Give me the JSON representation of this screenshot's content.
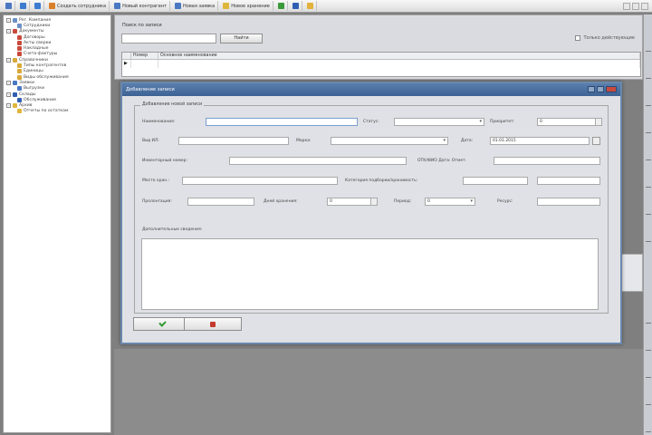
{
  "toolbar": {
    "items": [
      {
        "label": "",
        "icon": "back-icon",
        "color": "#4a78c2"
      },
      {
        "label": "",
        "icon": "up-icon",
        "color": "#3c7bd0"
      },
      {
        "label": "",
        "icon": "refresh-icon",
        "color": "#3c7bd0"
      },
      {
        "label": "Создать сотрудника",
        "icon": "new-employee-icon",
        "color": "#d97f2a"
      },
      {
        "label": "Новый контрагент",
        "icon": "new-contractor-icon",
        "color": "#4a78c2"
      },
      {
        "label": "Новая заявка",
        "icon": "new-request-icon",
        "color": "#4a78c2"
      },
      {
        "label": "Новое хранение",
        "icon": "new-storage-icon",
        "color": "#e0b63a"
      },
      {
        "label": "",
        "icon": "green-icon",
        "color": "#3a9a3a"
      },
      {
        "label": "",
        "icon": "blue-icon",
        "color": "#2f5fb3"
      },
      {
        "label": "",
        "icon": "star-icon",
        "color": "#e2b23a"
      }
    ]
  },
  "tree": [
    {
      "label": "Рег. Компания",
      "level": 1,
      "expander": "-",
      "color": "#6a8fc8"
    },
    {
      "label": "Сотрудники",
      "level": 2,
      "expander": "",
      "color": "#6a8fc8"
    },
    {
      "label": "Документы",
      "level": 1,
      "expander": "-",
      "color": "#c94a3c"
    },
    {
      "label": "Договоры",
      "level": 2,
      "expander": "",
      "color": "#c94a3c"
    },
    {
      "label": "Акты сверки",
      "level": 2,
      "expander": "",
      "color": "#c94a3c"
    },
    {
      "label": "Накладные",
      "level": 2,
      "expander": "",
      "color": "#c94a3c"
    },
    {
      "label": "Счета-фактуры",
      "level": 2,
      "expander": "",
      "color": "#c94a3c"
    },
    {
      "label": "Справочники",
      "level": 1,
      "expander": "-",
      "color": "#d9a83a"
    },
    {
      "label": "Типы контрагентов",
      "level": 2,
      "expander": "",
      "color": "#d9a83a"
    },
    {
      "label": "Единицы",
      "level": 2,
      "expander": "",
      "color": "#d9a83a"
    },
    {
      "label": "Виды обслуживания",
      "level": 2,
      "expander": "",
      "color": "#d9a83a"
    },
    {
      "label": "Заявки",
      "level": 1,
      "expander": "-",
      "color": "#4a78c2"
    },
    {
      "label": "Выгрузки",
      "level": 2,
      "expander": "",
      "color": "#4a78c2"
    },
    {
      "label": "Склады",
      "level": 1,
      "expander": "-",
      "color": "#2f5fb3"
    },
    {
      "label": "Обслуживание",
      "level": 2,
      "expander": "",
      "color": "#2f5fb3"
    },
    {
      "label": "Архив",
      "level": 1,
      "expander": "-",
      "color": "#e0b63a"
    },
    {
      "label": "Отчеты по остаткам",
      "level": 2,
      "expander": "",
      "color": "#e0b63a"
    }
  ],
  "search": {
    "label": "Поиск по записи",
    "value": "",
    "button": "Найти",
    "only_active_label": "Только действующие"
  },
  "grid": {
    "columns": [
      "",
      "Номер",
      "Основное наименование"
    ],
    "rows": [
      [
        "▶",
        "",
        ""
      ]
    ]
  },
  "dialog": {
    "title": "Добавление записи",
    "group_title": "Добавление новой записи",
    "fields": {
      "name_label": "Наименование:",
      "name_value": "",
      "status_label": "Статус:",
      "status_value": "",
      "priority_label": "Приоритет:",
      "priority_value": "0",
      "type_label": "Вид ИЛ:",
      "type_value": "",
      "mark_label": "Марка:",
      "mark_value": "",
      "date_label": "Дата:",
      "date_value": "01.01.2015",
      "inventory_label": "Инвентарный номер:",
      "inventory_value": "",
      "fio_label": "ОТК/ФИО Дата: Отмет.",
      "fio_value": "",
      "place_label": "Место хран.:",
      "place_value": "",
      "category_label": "Категория подборки/хранимость:",
      "category_value": "",
      "category_value2": "",
      "extra_label": "Пролонгация:",
      "extra_value": "",
      "days_label": "Дней хранения:",
      "days_value": "0",
      "period_label": "Период:",
      "period_value": "0",
      "resource_label": "Ресурс:",
      "resource_value": "",
      "memo_label": "Дополнительные сведения:"
    },
    "ok_icon": "ok-check-icon",
    "cancel_icon": "cancel-icon"
  }
}
